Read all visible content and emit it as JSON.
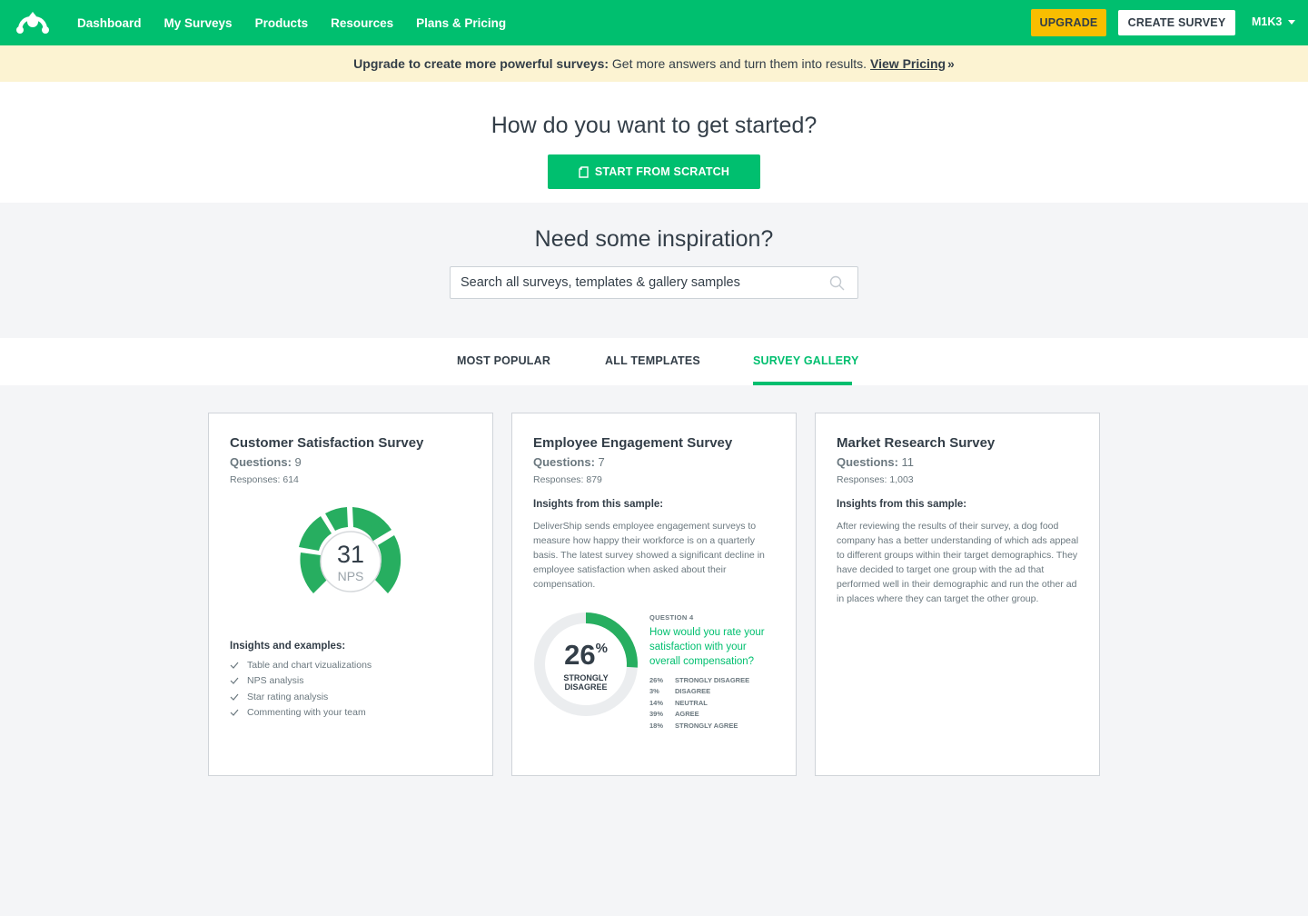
{
  "nav": {
    "links": [
      "Dashboard",
      "My Surveys",
      "Products",
      "Resources",
      "Plans & Pricing"
    ],
    "upgrade": "UPGRADE",
    "create_survey": "CREATE SURVEY",
    "user": "M1K3",
    "brand_color": "#00bf6f",
    "upgrade_color": "#f9be00"
  },
  "banner": {
    "bold": "Upgrade to create more powerful surveys:",
    "text": "Get more answers and turn them into results.",
    "link": "View Pricing",
    "suffix": "»"
  },
  "start": {
    "title": "How do you want to get started?",
    "button": "START FROM SCRATCH"
  },
  "inspiration": {
    "title": "Need some inspiration?",
    "search_placeholder": "Search all surveys, templates & gallery samples"
  },
  "tabs": [
    {
      "label": "MOST POPULAR",
      "active": false
    },
    {
      "label": "ALL TEMPLATES",
      "active": false
    },
    {
      "label": "SURVEY GALLERY",
      "active": true
    }
  ],
  "cards": [
    {
      "title": "Customer Satisfaction Survey",
      "questions_label": "Questions:",
      "questions": "9",
      "responses": "Responses: 614",
      "nps_value": "31",
      "nps_label": "NPS",
      "insights_title": "Insights and examples:",
      "insights": [
        "Table and chart vizualizations",
        "NPS analysis",
        "Star rating analysis",
        "Commenting with your team"
      ]
    },
    {
      "title": "Employee Engagement Survey",
      "questions_label": "Questions:",
      "questions": "7",
      "responses": "Responses: 879",
      "insights_title": "Insights from this sample:",
      "description": "DeliverShip sends employee engagement surveys to measure how happy their workforce is on a quarterly basis. The latest survey showed a significant decline in employee satisfaction when asked about their compensation.",
      "donut_value": "26",
      "donut_fraction": 0.26,
      "donut_unit": "%",
      "donut_label_line1": "STRONGLY",
      "donut_label_line2": "DISAGREE",
      "question_label": "QUESTION 4",
      "question_text": "How would you rate your satisfaction with your overall compensation?",
      "results": [
        {
          "pct": "26%",
          "label": "STRONGLY DISAGREE"
        },
        {
          "pct": "3%",
          "label": "DISAGREE"
        },
        {
          "pct": "14%",
          "label": "NEUTRAL"
        },
        {
          "pct": "39%",
          "label": "AGREE"
        },
        {
          "pct": "18%",
          "label": "STRONGLY AGREE"
        }
      ]
    },
    {
      "title": "Market Research Survey",
      "questions_label": "Questions:",
      "questions": "11",
      "responses": "Responses: 1,003",
      "insights_title": "Insights from this sample:",
      "description": "After reviewing the results of their survey, a dog food company has a better understanding of which ads appeal to different groups within their target demographics. They have decided to target one group with the ad that performed well in their demographic and run the other ad in places where they can target the other group."
    }
  ]
}
